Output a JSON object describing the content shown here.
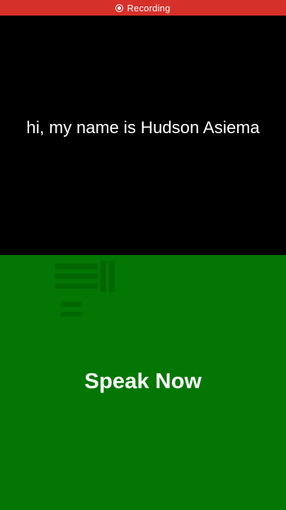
{
  "status_bar": {
    "icon": "record-icon",
    "label": "Recording",
    "color": "#d6302a"
  },
  "transcript": {
    "text": "hi, my name is Hudson Asiema",
    "background": "#000000"
  },
  "speak_button": {
    "label": "Speak Now",
    "background": "#037603"
  }
}
